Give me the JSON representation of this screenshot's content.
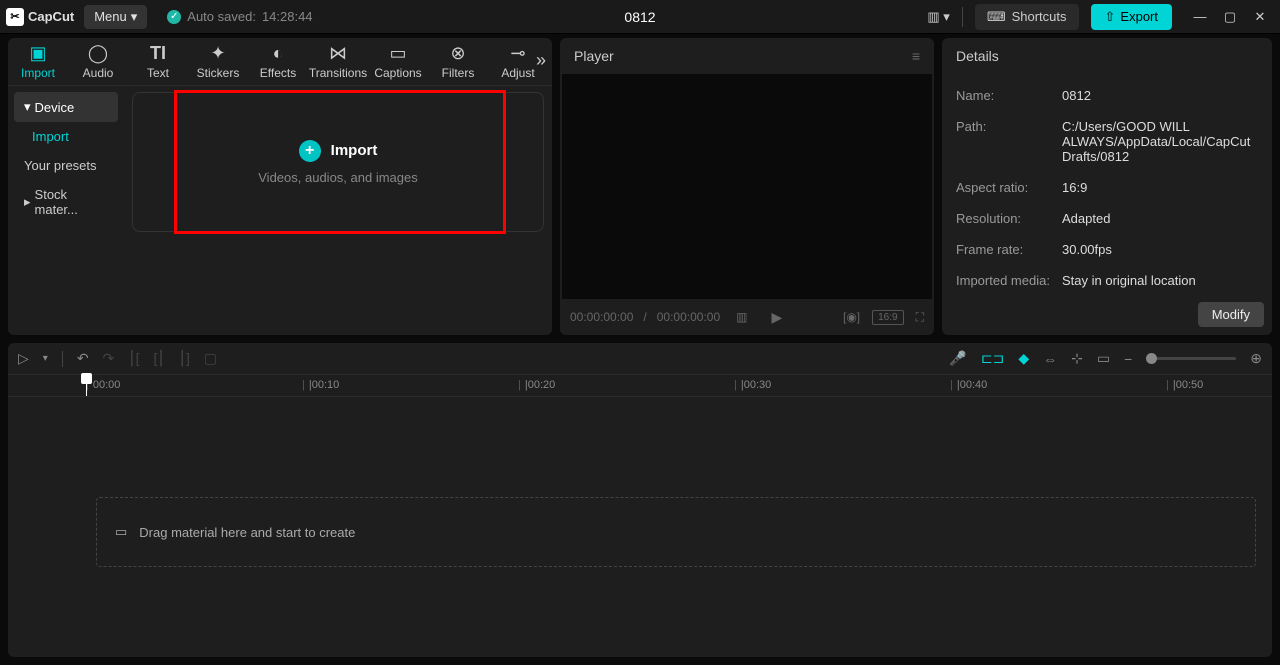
{
  "app": {
    "name": "CapCut",
    "menu_label": "Menu"
  },
  "autosave": {
    "prefix": "Auto saved:",
    "time": "14:28:44"
  },
  "project_title": "0812",
  "shortcuts_label": "Shortcuts",
  "export_label": "Export",
  "tools": [
    {
      "label": "Import",
      "icon": "▣"
    },
    {
      "label": "Audio",
      "icon": "◯"
    },
    {
      "label": "Text",
      "icon": "TI"
    },
    {
      "label": "Stickers",
      "icon": "✦"
    },
    {
      "label": "Effects",
      "icon": "◐"
    },
    {
      "label": "Transitions",
      "icon": "⋈"
    },
    {
      "label": "Captions",
      "icon": "▭"
    },
    {
      "label": "Filters",
      "icon": "⊗"
    },
    {
      "label": "Adjust",
      "icon": "⊸"
    }
  ],
  "sidebar": {
    "device": "Device",
    "import": "Import",
    "presets": "Your presets",
    "stock": "Stock mater..."
  },
  "import_card": {
    "title": "Import",
    "subtitle": "Videos, audios, and images"
  },
  "player": {
    "title": "Player",
    "time_current": "00:00:00:00",
    "time_total": "00:00:00:00",
    "ratio": "16:9"
  },
  "details": {
    "title": "Details",
    "rows": [
      {
        "label": "Name:",
        "value": "0812"
      },
      {
        "label": "Path:",
        "value": "C:/Users/GOOD WILL ALWAYS/AppData/Local/CapCut Drafts/0812"
      },
      {
        "label": "Aspect ratio:",
        "value": "16:9"
      },
      {
        "label": "Resolution:",
        "value": "Adapted"
      },
      {
        "label": "Frame rate:",
        "value": "30.00fps"
      },
      {
        "label": "Imported media:",
        "value": "Stay in original location"
      }
    ],
    "modify": "Modify"
  },
  "ruler": [
    "00:00",
    "|00:10",
    "|00:20",
    "|00:30",
    "|00:40",
    "|00:50"
  ],
  "dropzone": "Drag material here and start to create"
}
